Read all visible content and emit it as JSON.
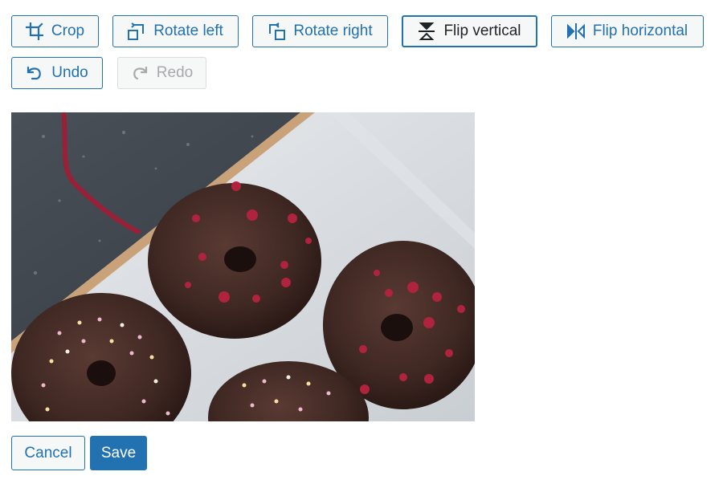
{
  "toolbar": {
    "crop": {
      "label": "Crop",
      "icon": "crop-icon"
    },
    "rotate_left": {
      "label": "Rotate left",
      "icon": "rotate-left-icon"
    },
    "rotate_right": {
      "label": "Rotate right",
      "icon": "rotate-right-icon"
    },
    "flip_vertical": {
      "label": "Flip vertical",
      "icon": "flip-vertical-icon",
      "pressed": true
    },
    "flip_horizontal": {
      "label": "Flip horizontal",
      "icon": "flip-horizontal-icon"
    },
    "undo": {
      "label": "Undo",
      "icon": "undo-icon"
    },
    "redo": {
      "label": "Redo",
      "icon": "redo-icon",
      "disabled": true
    }
  },
  "preview": {
    "subject": "chocolate donuts in a white box on dark stone surface"
  },
  "actions": {
    "cancel_label": "Cancel",
    "save_label": "Save"
  },
  "colors": {
    "accent": "#2271b1",
    "pressed_text": "#1d2327",
    "disabled": "#a7aaad",
    "button_bg": "#f6f7f7"
  }
}
